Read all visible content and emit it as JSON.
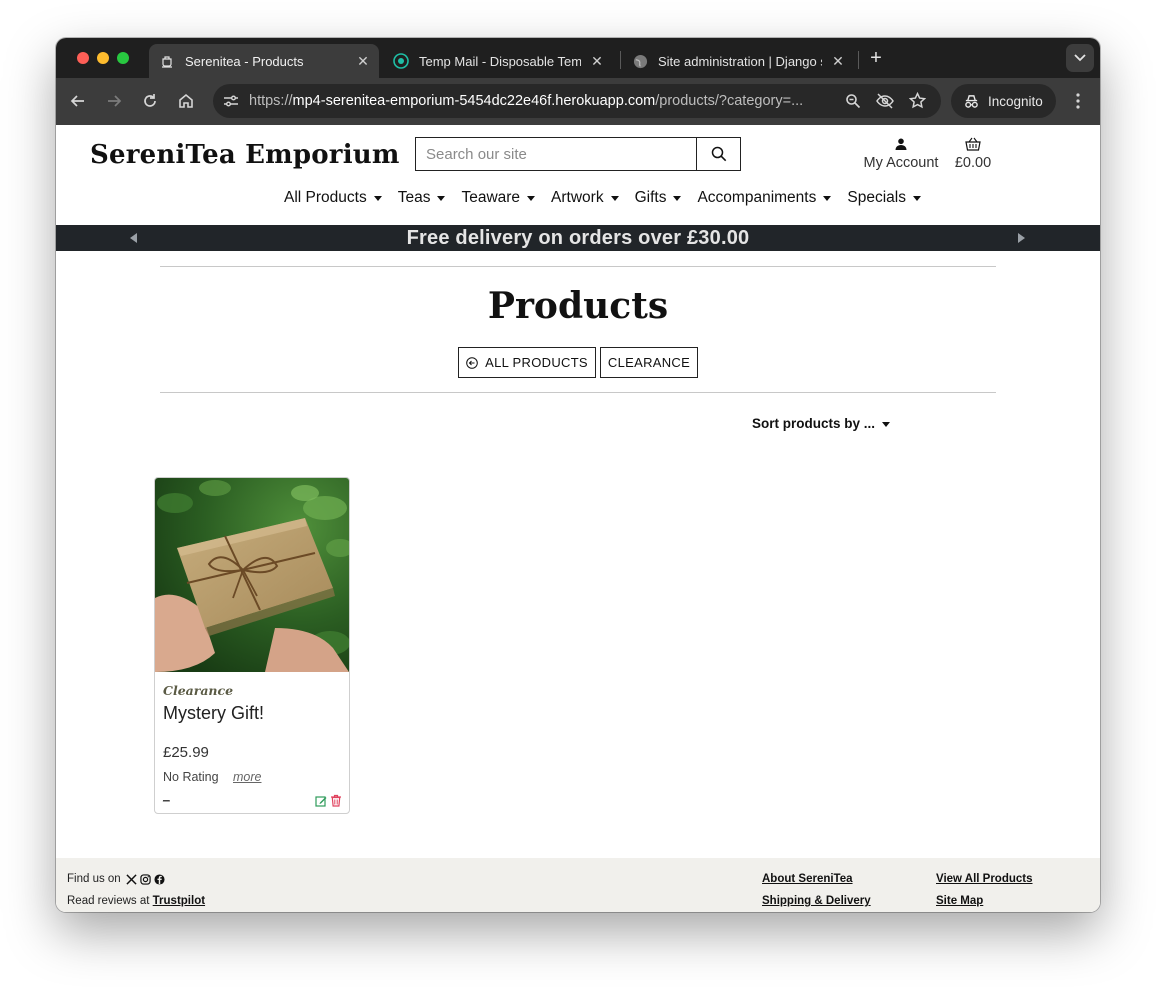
{
  "browser": {
    "tabs": [
      {
        "title": "Serenitea - Products",
        "favicon": "teapot-icon",
        "active": true
      },
      {
        "title": "Temp Mail - Disposable Temp",
        "favicon": "tempmail-icon",
        "active": false
      },
      {
        "title": "Site administration | Django s",
        "favicon": "globe-icon",
        "active": false
      }
    ],
    "url_prefix": "https://",
    "url_host": "mp4-serenitea-emporium-5454dc22e46f.herokuapp.com",
    "url_path": "/products/?category=...",
    "incognito_label": "Incognito"
  },
  "site": {
    "logo": "SereniTea Emporium",
    "search_placeholder": "Search our site",
    "account_label": "My Account",
    "bag_total": "£0.00",
    "nav": [
      "All Products",
      "Teas",
      "Teaware",
      "Artwork",
      "Gifts",
      "Accompaniments",
      "Specials"
    ],
    "banner": "Free delivery on orders over £30.00"
  },
  "main": {
    "heading": "Products",
    "filters": [
      "ALL PRODUCTS",
      "CLEARANCE"
    ],
    "sort_label": "Sort products by ...",
    "products": [
      {
        "category": "Clearance",
        "name": "Mystery Gift!",
        "price": "£25.99",
        "rating": "No Rating",
        "more": "more",
        "dash": "_"
      }
    ]
  },
  "footer": {
    "find_us": "Find us on",
    "reviews_prefix": "Read reviews at",
    "reviews_link": "Trustpilot",
    "links": [
      "About SereniTea",
      "Shipping & Delivery",
      "View All Products",
      "Site Map"
    ]
  },
  "colors": {
    "banner_bg": "#212529",
    "footer_bg": "#f1f0ec",
    "edit_icon": "#2e9b5b",
    "delete_icon": "#e0425e"
  }
}
